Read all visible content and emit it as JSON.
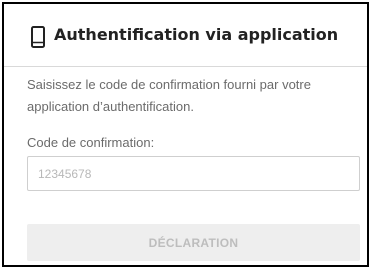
{
  "header": {
    "icon": "mobile-phone-icon",
    "title": "Authentification via application"
  },
  "description": "Saisissez le code de confirmation fourni par votre application d’authentification.",
  "code_field": {
    "label": "Code de confirmation:",
    "placeholder": "12345678",
    "value": ""
  },
  "submit": {
    "label": "DÉCLARATION",
    "enabled": false
  },
  "colors": {
    "border": "#000000",
    "button_bg": "#eeeeee",
    "button_text": "#bdbdbd",
    "muted_text": "#6b6b6b"
  }
}
